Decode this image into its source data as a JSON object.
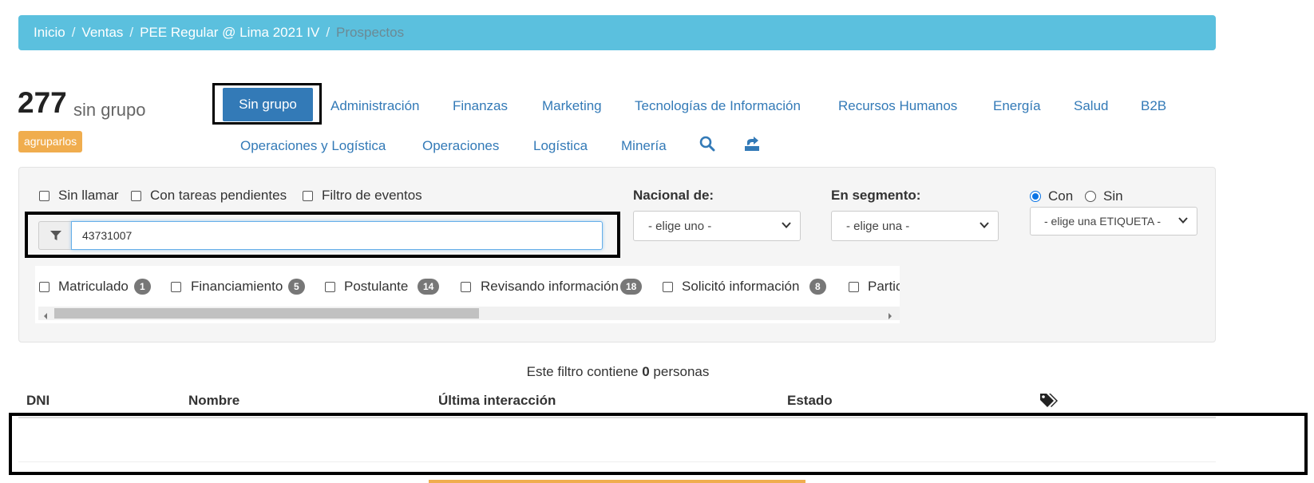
{
  "breadcrumb": {
    "items": [
      "Inicio",
      "Ventas",
      "PEE Regular @ Lima 2021 IV"
    ],
    "separator": "/",
    "active": "Prospectos"
  },
  "counter": {
    "number": "277",
    "label": "sin grupo",
    "group_button": "agruparlos"
  },
  "tabs": {
    "active": "Sin grupo",
    "row1": [
      "Administración",
      "Finanzas",
      "Marketing",
      "Tecnologías de Información",
      "Recursos Humanos",
      "Energía",
      "Salud",
      "B2B"
    ],
    "row2": [
      "Operaciones y Logística",
      "Operaciones",
      "Logística",
      "Minería"
    ],
    "icons": [
      "search-icon",
      "export-icon"
    ]
  },
  "filters": {
    "checkboxes": [
      "Sin llamar",
      "Con tareas pendientes",
      "Filtro de eventos"
    ],
    "search_value": "43731007",
    "nacional_label": "Nacional de:",
    "nacional_placeholder": "- elige uno -",
    "segmento_label": "En segmento:",
    "segmento_placeholder": "- elige una -",
    "tag_radio_con": "Con",
    "tag_radio_sin": "Sin",
    "tag_radio_selected": "Con",
    "tag_placeholder": "- elige una ETIQUETA -"
  },
  "statuses": [
    {
      "label": "Matriculado",
      "count": "1"
    },
    {
      "label": "Financiamiento",
      "count": "5"
    },
    {
      "label": "Postulante",
      "count": "14"
    },
    {
      "label": "Revisando información",
      "count": "18"
    },
    {
      "label": "Solicitó información",
      "count": "8"
    },
    {
      "label": "Partic",
      "count": ""
    }
  ],
  "summary": {
    "prefix": "Este filtro contiene",
    "count": "0",
    "suffix": "personas"
  },
  "table": {
    "columns": [
      "DNI",
      "Nombre",
      "Última interacción",
      "Estado"
    ],
    "tag_column_icon": "tags-icon"
  },
  "colors": {
    "breadcrumb_bg": "#5bc0de",
    "primary": "#337ab7",
    "badge_orange": "#f0ad4e",
    "pill_gray": "#777777"
  }
}
